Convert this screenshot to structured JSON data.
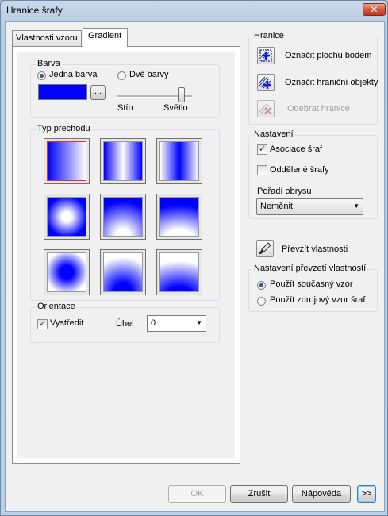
{
  "window": {
    "title": "Hranice šrafy",
    "close_glyph": "✕"
  },
  "tabs": [
    {
      "label": "Vlastnosti vzoru",
      "active": false
    },
    {
      "label": "Gradient",
      "active": true
    }
  ],
  "color_group": {
    "title": "Barva",
    "one_color_label": "Jedna barva",
    "two_colors_label": "Dvě barvy",
    "selected": "one",
    "color": "#0000ff",
    "browse_label": "...",
    "shade_label": "Stín",
    "tint_label": "Světlo",
    "slider_value": 1.0
  },
  "gradient_group": {
    "title": "Typ přechodu",
    "selected_index": 0,
    "patterns": [
      "linear-horizontal",
      "cylinder-horizontal",
      "inv-cylinder-horizontal",
      "spherical",
      "hemispherical",
      "curved",
      "inv-spherical",
      "inv-hemispherical",
      "inv-curved"
    ]
  },
  "orientation_group": {
    "title": "Orientace",
    "center_label": "Vystředit",
    "center_checked": true,
    "angle_label": "Úhel",
    "angle_value": "0"
  },
  "boundaries": {
    "title": "Hranice",
    "add_pick_points": "Označit plochu bodem",
    "add_select_objects": "Označit hraniční objekty",
    "remove_boundaries": "Odebrat hranice"
  },
  "options": {
    "title": "Nastavení",
    "associative_label": "Asociace šraf",
    "associative_checked": true,
    "separate_label": "Oddělené šrafy",
    "separate_checked": false,
    "draw_order_label": "Pořadí obrysu",
    "draw_order_value": "Neměnit"
  },
  "inherit": {
    "button_label": "Převzít vlastnosti",
    "group_title": "Nastavení převzetí vlastností",
    "use_current_label": "Použít současný vzor",
    "use_source_label": "Použít zdrojový vzor šraf",
    "selected": "current"
  },
  "footer": {
    "ok_label": "OK",
    "cancel_label": "Zrušit",
    "help_label": "Nápověda",
    "more_label": ">>"
  }
}
